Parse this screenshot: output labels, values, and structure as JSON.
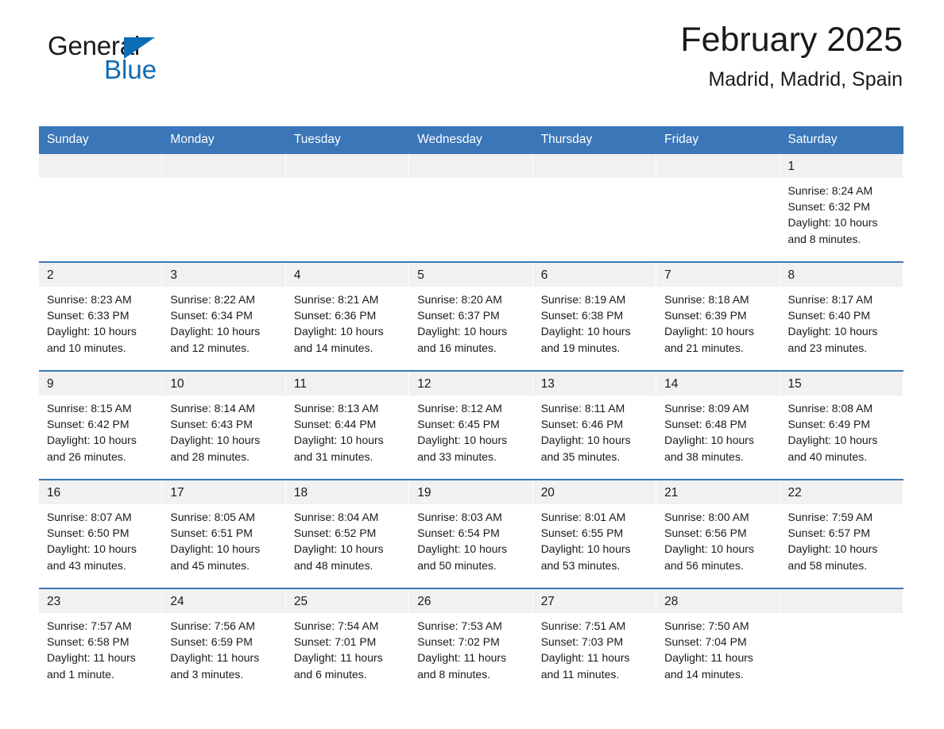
{
  "brand": {
    "name_part1": "General",
    "name_part2": "Blue",
    "logo_icon": "blue-triangle-logo",
    "accent_color": "#0d6cb6"
  },
  "header": {
    "title": "February 2025",
    "subtitle": "Madrid, Madrid, Spain"
  },
  "theme": {
    "header_blue": "#3a76b8",
    "daynum_band": "#f1f1f1",
    "text": "#1a1a1a"
  },
  "calendar": {
    "weekday_headers": [
      "Sunday",
      "Monday",
      "Tuesday",
      "Wednesday",
      "Thursday",
      "Friday",
      "Saturday"
    ],
    "weeks": [
      [
        {
          "day": "",
          "empty": true
        },
        {
          "day": "",
          "empty": true
        },
        {
          "day": "",
          "empty": true
        },
        {
          "day": "",
          "empty": true
        },
        {
          "day": "",
          "empty": true
        },
        {
          "day": "",
          "empty": true
        },
        {
          "day": "1",
          "sunrise": "Sunrise: 8:24 AM",
          "sunset": "Sunset: 6:32 PM",
          "daylight": "Daylight: 10 hours and 8 minutes."
        }
      ],
      [
        {
          "day": "2",
          "sunrise": "Sunrise: 8:23 AM",
          "sunset": "Sunset: 6:33 PM",
          "daylight": "Daylight: 10 hours and 10 minutes."
        },
        {
          "day": "3",
          "sunrise": "Sunrise: 8:22 AM",
          "sunset": "Sunset: 6:34 PM",
          "daylight": "Daylight: 10 hours and 12 minutes."
        },
        {
          "day": "4",
          "sunrise": "Sunrise: 8:21 AM",
          "sunset": "Sunset: 6:36 PM",
          "daylight": "Daylight: 10 hours and 14 minutes."
        },
        {
          "day": "5",
          "sunrise": "Sunrise: 8:20 AM",
          "sunset": "Sunset: 6:37 PM",
          "daylight": "Daylight: 10 hours and 16 minutes."
        },
        {
          "day": "6",
          "sunrise": "Sunrise: 8:19 AM",
          "sunset": "Sunset: 6:38 PM",
          "daylight": "Daylight: 10 hours and 19 minutes."
        },
        {
          "day": "7",
          "sunrise": "Sunrise: 8:18 AM",
          "sunset": "Sunset: 6:39 PM",
          "daylight": "Daylight: 10 hours and 21 minutes."
        },
        {
          "day": "8",
          "sunrise": "Sunrise: 8:17 AM",
          "sunset": "Sunset: 6:40 PM",
          "daylight": "Daylight: 10 hours and 23 minutes."
        }
      ],
      [
        {
          "day": "9",
          "sunrise": "Sunrise: 8:15 AM",
          "sunset": "Sunset: 6:42 PM",
          "daylight": "Daylight: 10 hours and 26 minutes."
        },
        {
          "day": "10",
          "sunrise": "Sunrise: 8:14 AM",
          "sunset": "Sunset: 6:43 PM",
          "daylight": "Daylight: 10 hours and 28 minutes."
        },
        {
          "day": "11",
          "sunrise": "Sunrise: 8:13 AM",
          "sunset": "Sunset: 6:44 PM",
          "daylight": "Daylight: 10 hours and 31 minutes."
        },
        {
          "day": "12",
          "sunrise": "Sunrise: 8:12 AM",
          "sunset": "Sunset: 6:45 PM",
          "daylight": "Daylight: 10 hours and 33 minutes."
        },
        {
          "day": "13",
          "sunrise": "Sunrise: 8:11 AM",
          "sunset": "Sunset: 6:46 PM",
          "daylight": "Daylight: 10 hours and 35 minutes."
        },
        {
          "day": "14",
          "sunrise": "Sunrise: 8:09 AM",
          "sunset": "Sunset: 6:48 PM",
          "daylight": "Daylight: 10 hours and 38 minutes."
        },
        {
          "day": "15",
          "sunrise": "Sunrise: 8:08 AM",
          "sunset": "Sunset: 6:49 PM",
          "daylight": "Daylight: 10 hours and 40 minutes."
        }
      ],
      [
        {
          "day": "16",
          "sunrise": "Sunrise: 8:07 AM",
          "sunset": "Sunset: 6:50 PM",
          "daylight": "Daylight: 10 hours and 43 minutes."
        },
        {
          "day": "17",
          "sunrise": "Sunrise: 8:05 AM",
          "sunset": "Sunset: 6:51 PM",
          "daylight": "Daylight: 10 hours and 45 minutes."
        },
        {
          "day": "18",
          "sunrise": "Sunrise: 8:04 AM",
          "sunset": "Sunset: 6:52 PM",
          "daylight": "Daylight: 10 hours and 48 minutes."
        },
        {
          "day": "19",
          "sunrise": "Sunrise: 8:03 AM",
          "sunset": "Sunset: 6:54 PM",
          "daylight": "Daylight: 10 hours and 50 minutes."
        },
        {
          "day": "20",
          "sunrise": "Sunrise: 8:01 AM",
          "sunset": "Sunset: 6:55 PM",
          "daylight": "Daylight: 10 hours and 53 minutes."
        },
        {
          "day": "21",
          "sunrise": "Sunrise: 8:00 AM",
          "sunset": "Sunset: 6:56 PM",
          "daylight": "Daylight: 10 hours and 56 minutes."
        },
        {
          "day": "22",
          "sunrise": "Sunrise: 7:59 AM",
          "sunset": "Sunset: 6:57 PM",
          "daylight": "Daylight: 10 hours and 58 minutes."
        }
      ],
      [
        {
          "day": "23",
          "sunrise": "Sunrise: 7:57 AM",
          "sunset": "Sunset: 6:58 PM",
          "daylight": "Daylight: 11 hours and 1 minute."
        },
        {
          "day": "24",
          "sunrise": "Sunrise: 7:56 AM",
          "sunset": "Sunset: 6:59 PM",
          "daylight": "Daylight: 11 hours and 3 minutes."
        },
        {
          "day": "25",
          "sunrise": "Sunrise: 7:54 AM",
          "sunset": "Sunset: 7:01 PM",
          "daylight": "Daylight: 11 hours and 6 minutes."
        },
        {
          "day": "26",
          "sunrise": "Sunrise: 7:53 AM",
          "sunset": "Sunset: 7:02 PM",
          "daylight": "Daylight: 11 hours and 8 minutes."
        },
        {
          "day": "27",
          "sunrise": "Sunrise: 7:51 AM",
          "sunset": "Sunset: 7:03 PM",
          "daylight": "Daylight: 11 hours and 11 minutes."
        },
        {
          "day": "28",
          "sunrise": "Sunrise: 7:50 AM",
          "sunset": "Sunset: 7:04 PM",
          "daylight": "Daylight: 11 hours and 14 minutes."
        },
        {
          "day": "",
          "empty": true
        }
      ]
    ]
  }
}
